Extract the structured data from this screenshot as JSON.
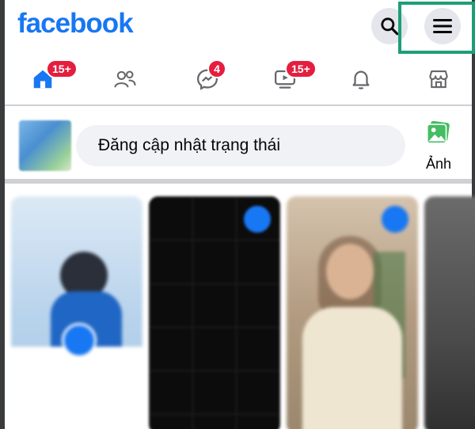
{
  "header": {
    "logo_text": "facebook",
    "search_icon": "search-icon",
    "menu_icon": "hamburger-menu-icon"
  },
  "nav": {
    "items": [
      {
        "name": "home",
        "icon": "home-icon",
        "badge": "15+",
        "active": true
      },
      {
        "name": "friends",
        "icon": "friends-icon",
        "badge": ""
      },
      {
        "name": "messenger",
        "icon": "messenger-icon",
        "badge": "4"
      },
      {
        "name": "watch",
        "icon": "video-icon",
        "badge": "15+"
      },
      {
        "name": "notifications",
        "icon": "bell-icon",
        "badge": ""
      },
      {
        "name": "marketplace",
        "icon": "store-icon",
        "badge": ""
      }
    ]
  },
  "composer": {
    "status_placeholder": "Đăng cập nhật trạng thái",
    "photo_label": "Ảnh"
  },
  "colors": {
    "brand": "#1877f2",
    "badge": "#e41e3f",
    "highlight": "#1e9e77",
    "input_bg": "#f0f2f5"
  }
}
